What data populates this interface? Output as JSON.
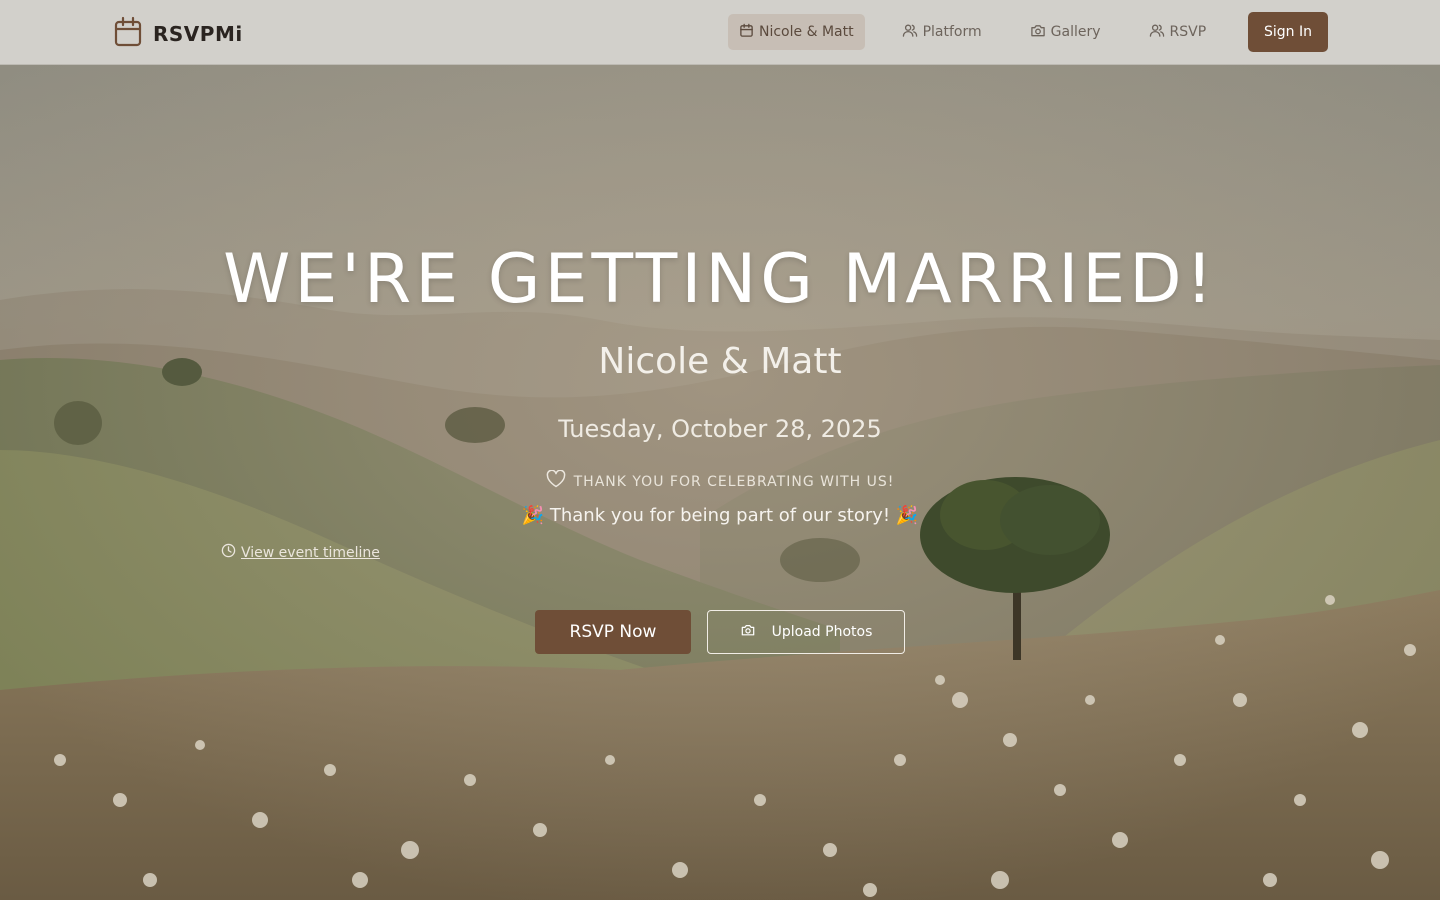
{
  "brand": {
    "name": "RSVPMi",
    "icon": "calendar-icon"
  },
  "nav": {
    "items": [
      {
        "label": "Nicole & Matt",
        "icon": "calendar-icon",
        "active": true
      },
      {
        "label": "Platform",
        "icon": "users-icon",
        "active": false
      },
      {
        "label": "Gallery",
        "icon": "camera-icon",
        "active": false
      },
      {
        "label": "RSVP",
        "icon": "users-icon",
        "active": false
      }
    ],
    "signin_label": "Sign In"
  },
  "hero": {
    "title": "WE'RE GETTING MARRIED!",
    "couple": "Nicole & Matt",
    "date": "Tuesday, October 28, 2025",
    "thanks": "THANK YOU FOR CELEBRATING WITH US!",
    "story": "🎉 Thank you for being part of our story! 🎉",
    "timeline_link": "View event timeline",
    "rsvp_button": "RSVP Now",
    "upload_button": "Upload Photos"
  },
  "colors": {
    "accent": "#6f4e37",
    "nav_bg": "#d2d0cb",
    "nav_active_bg": "#c7beb5"
  }
}
